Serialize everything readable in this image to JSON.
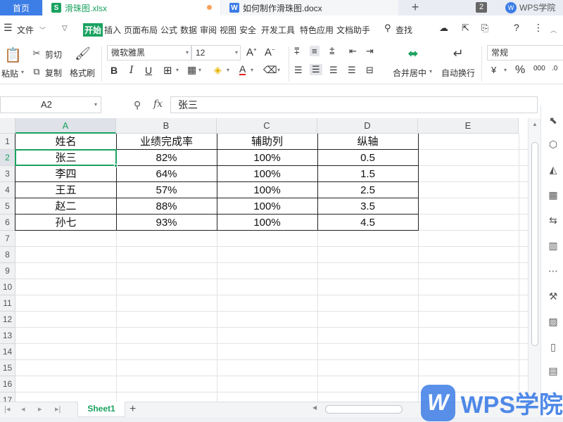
{
  "tabs": {
    "home": "首页",
    "workbook": "滑珠图.xlsx",
    "document": "如何制作滑珠图.docx",
    "add": "+",
    "window_count": "2",
    "brand": "WPS学院"
  },
  "menu": {
    "file": "文件",
    "items": [
      "开始",
      "插入",
      "页面布局",
      "公式",
      "数据",
      "审阅",
      "视图",
      "安全",
      "开发工具",
      "特色应用",
      "文档助手"
    ],
    "search": "查找"
  },
  "ribbon": {
    "paste": "粘贴",
    "cut": "剪切",
    "copy": "复制",
    "format_painter": "格式刷",
    "font_name": "微软雅黑",
    "font_size": "12",
    "bold": "B",
    "italic": "I",
    "underline": "U",
    "merge_center": "合并居中",
    "wrap_text": "自动换行",
    "number_format": "常规",
    "percent": "%"
  },
  "formula_bar": {
    "name_box": "A2",
    "fx": "fx",
    "content": "张三"
  },
  "sheet": {
    "columns": [
      "A",
      "B",
      "C",
      "D",
      "E"
    ],
    "rows": [
      "1",
      "2",
      "3",
      "4",
      "5",
      "6",
      "7",
      "8",
      "9",
      "10",
      "11",
      "12",
      "13",
      "14",
      "15",
      "16",
      "17"
    ],
    "headers": [
      "姓名",
      "业绩完成率",
      "辅助列",
      "纵轴"
    ],
    "data": [
      [
        "张三",
        "82%",
        "100%",
        "0.5"
      ],
      [
        "李四",
        "64%",
        "100%",
        "1.5"
      ],
      [
        "王五",
        "57%",
        "100%",
        "2.5"
      ],
      [
        "赵二",
        "88%",
        "100%",
        "3.5"
      ],
      [
        "孙七",
        "93%",
        "100%",
        "4.5"
      ]
    ],
    "active_cell": "A2"
  },
  "sheet_tabs": {
    "active": "Sheet1",
    "add": "+"
  },
  "watermark": {
    "text": "WPS学院"
  },
  "colors": {
    "accent_green": "#1aa260",
    "tab_blue": "#3d7de6",
    "header_gray": "#f0f1f3"
  }
}
